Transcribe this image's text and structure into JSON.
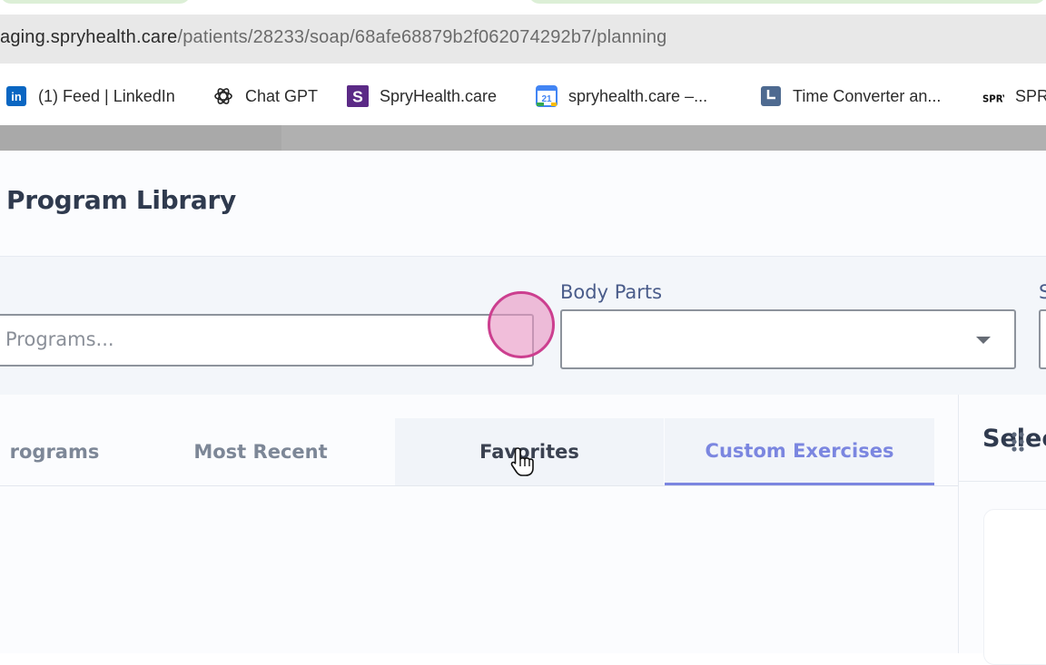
{
  "browser": {
    "url_host": "aging.spryhealth.care",
    "url_path": "/patients/28233/soap/68afe68879b2f062074292b7/planning",
    "bookmarks": [
      {
        "label": "(1) Feed | LinkedIn",
        "icon": "linkedin-icon"
      },
      {
        "label": "Chat GPT",
        "icon": "openai-icon"
      },
      {
        "label": "SpryHealth.care",
        "icon": "spry-s-icon"
      },
      {
        "label": "spryhealth.care –...",
        "icon": "google-calendar-icon",
        "icon_text": "21"
      },
      {
        "label": "Time Converter an...",
        "icon": "clock-icon"
      },
      {
        "label": "SPR",
        "icon": "spry-logo-icon",
        "icon_text": "SPRY"
      }
    ]
  },
  "page": {
    "title": "Program Library"
  },
  "filters": {
    "search_placeholder": "Programs...",
    "body_parts_label": "Body Parts",
    "body_parts_value": "",
    "next_label": "S"
  },
  "tabs": [
    {
      "label": "rograms",
      "state": "normal"
    },
    {
      "label": "Most Recent",
      "state": "normal"
    },
    {
      "label": "Favorites",
      "state": "hover"
    },
    {
      "label": "Custom Exercises",
      "state": "active"
    }
  ],
  "right_panel": {
    "title": "Selec"
  },
  "colors": {
    "accent": "#7b86e0",
    "title_text": "#2f3a4e",
    "click_marker": "#cc3f8f"
  }
}
